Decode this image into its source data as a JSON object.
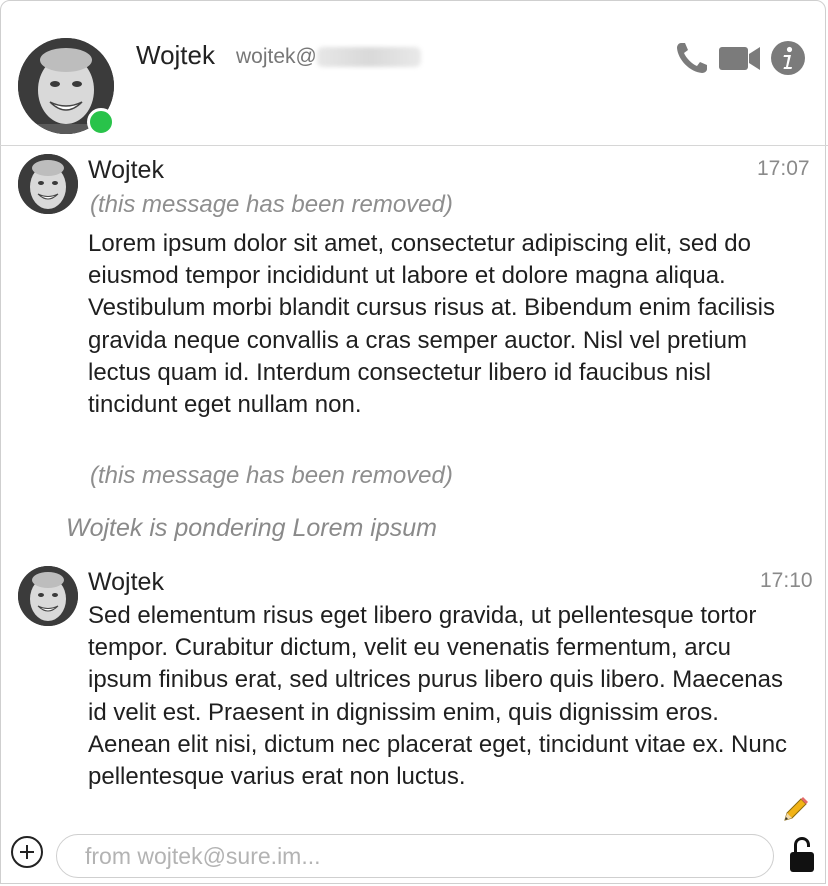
{
  "window": {
    "top_sliver_text": "…"
  },
  "header": {
    "contact_name": "Wojtek",
    "contact_email_prefix": "wojtek@",
    "online_status_color": "#29c34a",
    "icons": [
      "phone-icon",
      "video-camera-icon",
      "info-icon"
    ]
  },
  "messages": [
    {
      "sender": "Wojtek",
      "time": "17:07",
      "removed_note_1": "(this message has been removed)",
      "text": "Lorem ipsum dolor sit amet, consectetur adipiscing elit, sed do eiusmod tempor incididunt ut labore et dolore magna aliqua. Vestibulum morbi blandit cursus risus at. Bibendum enim facilisis gravida neque convallis a cras semper auctor. Nisl vel pretium lectus quam id. Interdum consectetur libero id faucibus nisl tincidunt eget nullam non.",
      "removed_note_2": "(this message has been removed)"
    },
    {
      "sender": "Wojtek",
      "time": "17:10",
      "text": "Sed elementum risus eget libero gravida, ut pellentesque tortor tempor. Curabitur dictum, velit eu venenatis fermentum, arcu ipsum finibus erat, sed ultrices purus libero quis libero. Maecenas id velit est. Praesent in dignissim enim, quis dignissim eros. Aenean elit nisi, dictum nec placerat eget, tincidunt vitae ex. Nunc pellentesque varius erat non luctus."
    }
  ],
  "status": {
    "who": "Wojtek",
    "text": " is pondering Lorem ipsum"
  },
  "composer": {
    "placeholder": "from wojtek@sure.im...",
    "value": ""
  }
}
